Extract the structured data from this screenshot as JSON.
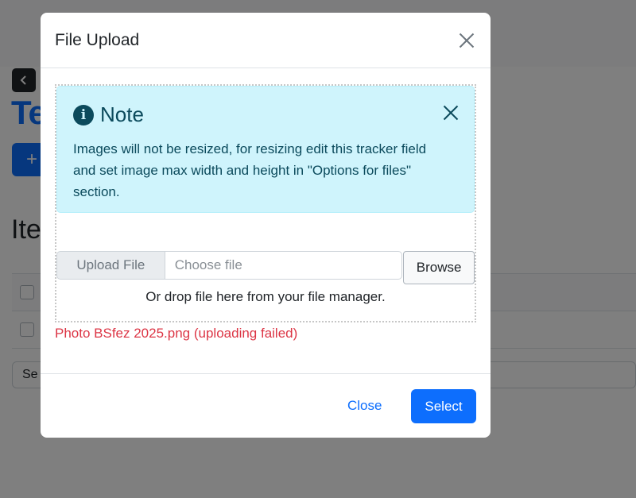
{
  "background": {
    "title_fragment": "Te",
    "add_button_label": "+",
    "section_heading_fragment": "Ite",
    "select_value_fragment": "Se"
  },
  "modal": {
    "title": "File Upload",
    "alert": {
      "heading": "Note",
      "icon": "info-circle-icon",
      "text": "Images will not be resized, for resizing edit this tracker field and set image max width and height in \"Options for files\" section."
    },
    "file_input": {
      "label": "Upload File",
      "placeholder": "Choose file",
      "browse_label": "Browse"
    },
    "drop_hint": "Or drop file here from your file manager.",
    "error_message": "Photo BSfez 2025.png (uploading failed)",
    "footer": {
      "close_label": "Close",
      "select_label": "Select"
    }
  },
  "colors": {
    "primary": "#0d6efd",
    "alert_bg": "#cff4fc",
    "alert_text": "#0b4a5c",
    "error": "#dc3545"
  }
}
